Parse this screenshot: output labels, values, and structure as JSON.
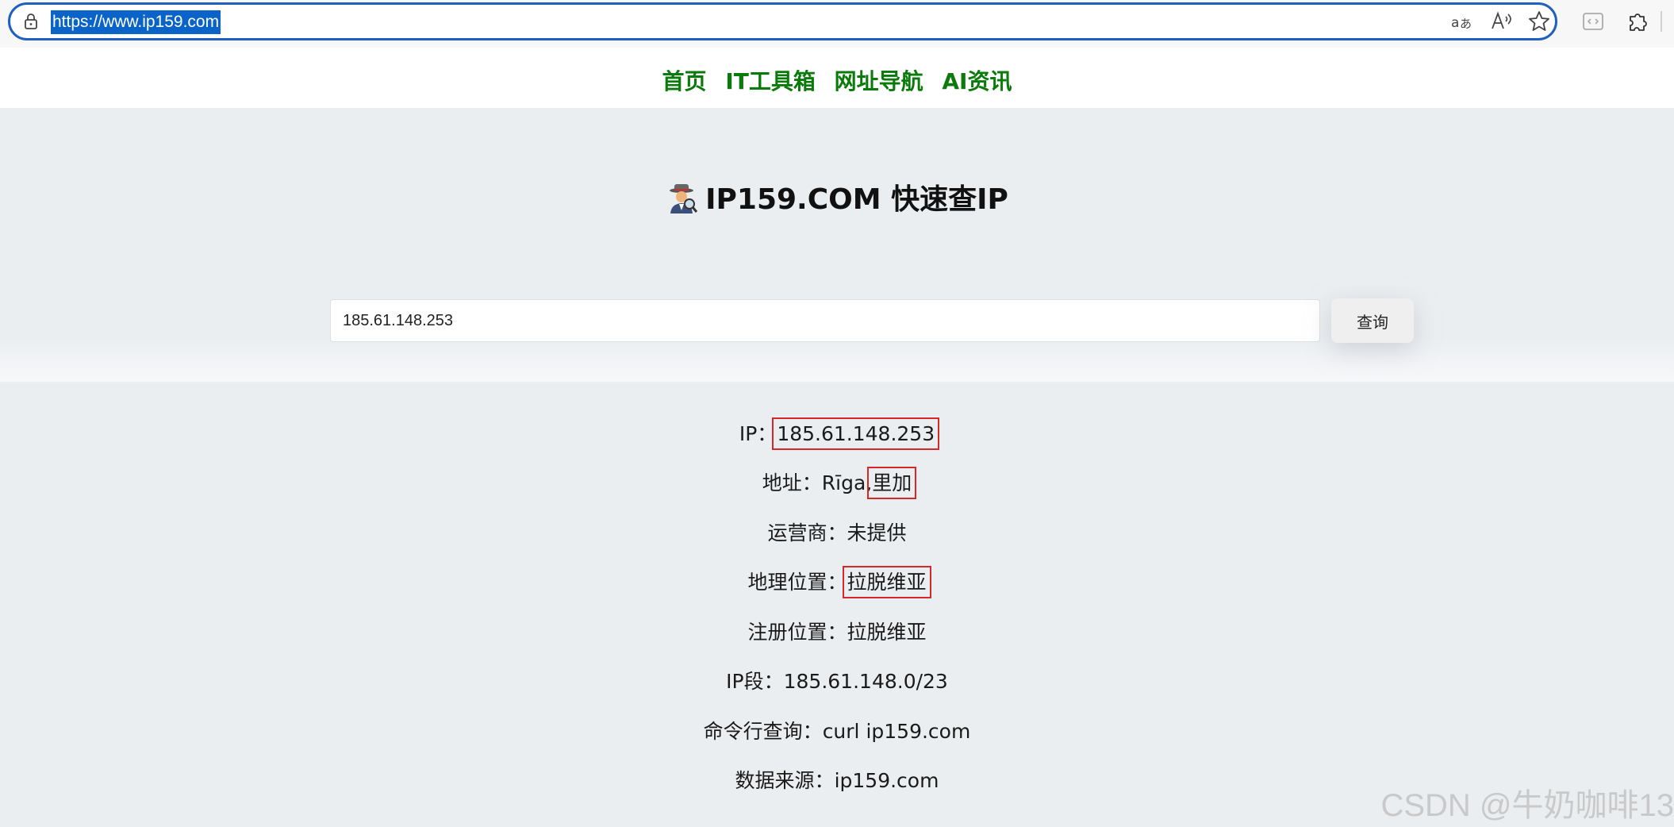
{
  "browser": {
    "url": "https://www.ip159.com"
  },
  "nav": {
    "items": [
      "首页",
      "IT工具箱",
      "网址导航",
      "AI资讯"
    ]
  },
  "hero": {
    "title": "IP159.COM 快速查IP",
    "search_value": "185.61.148.253",
    "search_button": "查询"
  },
  "results": {
    "ip_label": "IP：",
    "ip_value": "185.61.148.253",
    "addr_label": "地址：",
    "addr_value_a": "Rīga,",
    "addr_value_b": "里加",
    "isp_label": "运营商：",
    "isp_value": "未提供",
    "geo_label": "地理位置：",
    "geo_value": "拉脱维亚",
    "reg_label": "注册位置：",
    "reg_value": "拉脱维亚",
    "seg_label": "IP段：",
    "seg_value": "185.61.148.0/23",
    "cli_label": "命令行查询：",
    "cli_value": "curl ip159.com",
    "src_label": "数据来源：",
    "src_value": "ip159.com"
  },
  "watermark": "CSDN @牛奶咖啡13",
  "colors": {
    "nav_green": "#0a7a0a",
    "highlight_red": "#d62828",
    "url_select": "#0a64c7"
  }
}
